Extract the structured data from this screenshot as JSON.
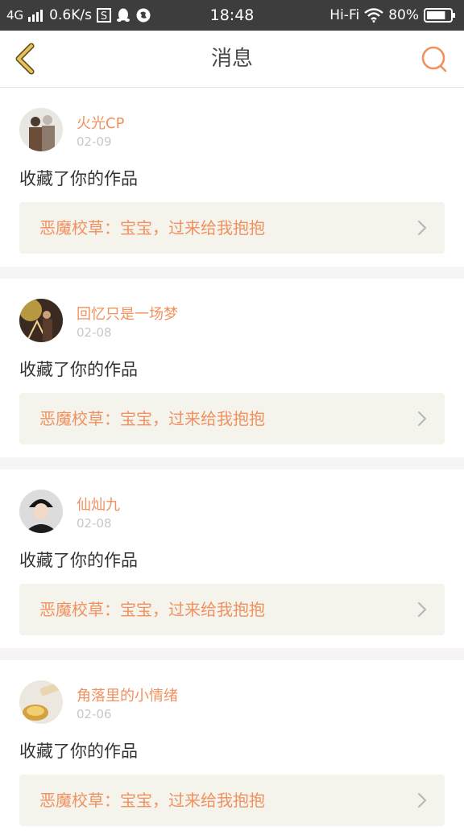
{
  "status_bar": {
    "network": "4G",
    "speed": "0.6K/s",
    "time": "18:48",
    "hifi": "Hi-Fi",
    "battery": "80%",
    "battery_level": 0.8
  },
  "nav": {
    "title": "消息",
    "back_icon": "chevron-left-icon",
    "search_icon": "search-icon"
  },
  "colors": {
    "accent": "#f0915f",
    "back_arrow": "#e8c15a",
    "work_bg": "#f4f4ed"
  },
  "messages": [
    {
      "username": "火光CP",
      "date": "02-09",
      "action": "收藏了你的作品",
      "work_title": "恶魔校草：宝宝，过来给我抱抱"
    },
    {
      "username": "回忆只是一场梦",
      "date": "02-08",
      "action": "收藏了你的作品",
      "work_title": "恶魔校草：宝宝，过来给我抱抱"
    },
    {
      "username": "仙灿九",
      "date": "02-08",
      "action": "收藏了你的作品",
      "work_title": "恶魔校草：宝宝，过来给我抱抱"
    },
    {
      "username": "角落里的小情绪",
      "date": "02-06",
      "action": "收藏了你的作品",
      "work_title": "恶魔校草：宝宝，过来给我抱抱"
    }
  ]
}
